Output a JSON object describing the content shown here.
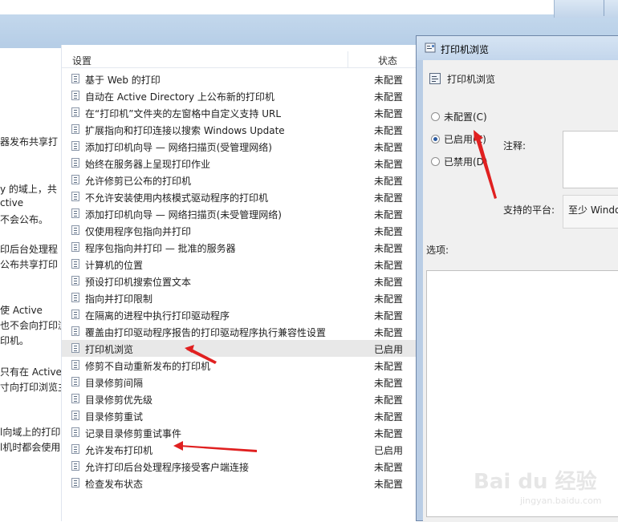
{
  "description_lines": [
    "器发布共享打",
    "y 的域上，共",
    "ctive",
    "不会公布。",
    "印后台处理程",
    "公布共享打印",
    "使 Active",
    "也不会向打印浏",
    "印机。",
    "只有在 Active",
    "寸向打印浏览主",
    "l向域上的打印",
    "l机时都会使用"
  ],
  "list": {
    "col_setting": "设置",
    "col_status": "状态",
    "rows": [
      {
        "name": "基于 Web 的打印",
        "status": "未配置"
      },
      {
        "name": "自动在 Active Directory 上公布新的打印机",
        "status": "未配置"
      },
      {
        "name": "在“打印机”文件夹的左窗格中自定义支持 URL",
        "status": "未配置"
      },
      {
        "name": "扩展指向和打印连接以搜索 Windows Update",
        "status": "未配置"
      },
      {
        "name": "添加打印机向导 — 网络扫描页(受管理网络)",
        "status": "未配置"
      },
      {
        "name": "始终在服务器上呈现打印作业",
        "status": "未配置"
      },
      {
        "name": "允许修剪已公布的打印机",
        "status": "未配置"
      },
      {
        "name": "不允许安装使用内核模式驱动程序的打印机",
        "status": "未配置"
      },
      {
        "name": "添加打印机向导 — 网络扫描页(未受管理网络)",
        "status": "未配置"
      },
      {
        "name": "仅使用程序包指向并打印",
        "status": "未配置"
      },
      {
        "name": "程序包指向并打印 — 批准的服务器",
        "status": "未配置"
      },
      {
        "name": "计算机的位置",
        "status": "未配置"
      },
      {
        "name": "预设打印机搜索位置文本",
        "status": "未配置"
      },
      {
        "name": "指向并打印限制",
        "status": "未配置"
      },
      {
        "name": "在隔离的进程中执行打印驱动程序",
        "status": "未配置"
      },
      {
        "name": "覆盖由打印驱动程序报告的打印驱动程序执行兼容性设置",
        "status": "未配置"
      },
      {
        "name": "打印机浏览",
        "status": "已启用"
      },
      {
        "name": "修剪不自动重新发布的打印机",
        "status": "未配置"
      },
      {
        "name": "目录修剪间隔",
        "status": "未配置"
      },
      {
        "name": "目录修剪优先级",
        "status": "未配置"
      },
      {
        "name": "目录修剪重试",
        "status": "未配置"
      },
      {
        "name": "记录目录修剪重试事件",
        "status": "未配置"
      },
      {
        "name": "允许发布打印机",
        "status": "已启用"
      },
      {
        "name": "允许打印后台处理程序接受客户端连接",
        "status": "未配置"
      },
      {
        "name": "检查发布状态",
        "status": "未配置"
      }
    ]
  },
  "dialog": {
    "title": "打印机浏览",
    "setting_name": "打印机浏览",
    "radio_not_configured": "未配置(C)",
    "radio_enabled": "已启用(E)",
    "radio_disabled": "已禁用(D)",
    "comment_label": "注释:",
    "platform_label": "支持的平台:",
    "platform_value": "至少 Windo",
    "options_label": "选项:",
    "selected_radio": "enabled"
  },
  "watermark": {
    "logo": "Bai du 经验",
    "url": "jingyan.baidu.com"
  },
  "colors": {
    "arrow_red": "#e02020",
    "selected_row": "#e8e8e8"
  }
}
